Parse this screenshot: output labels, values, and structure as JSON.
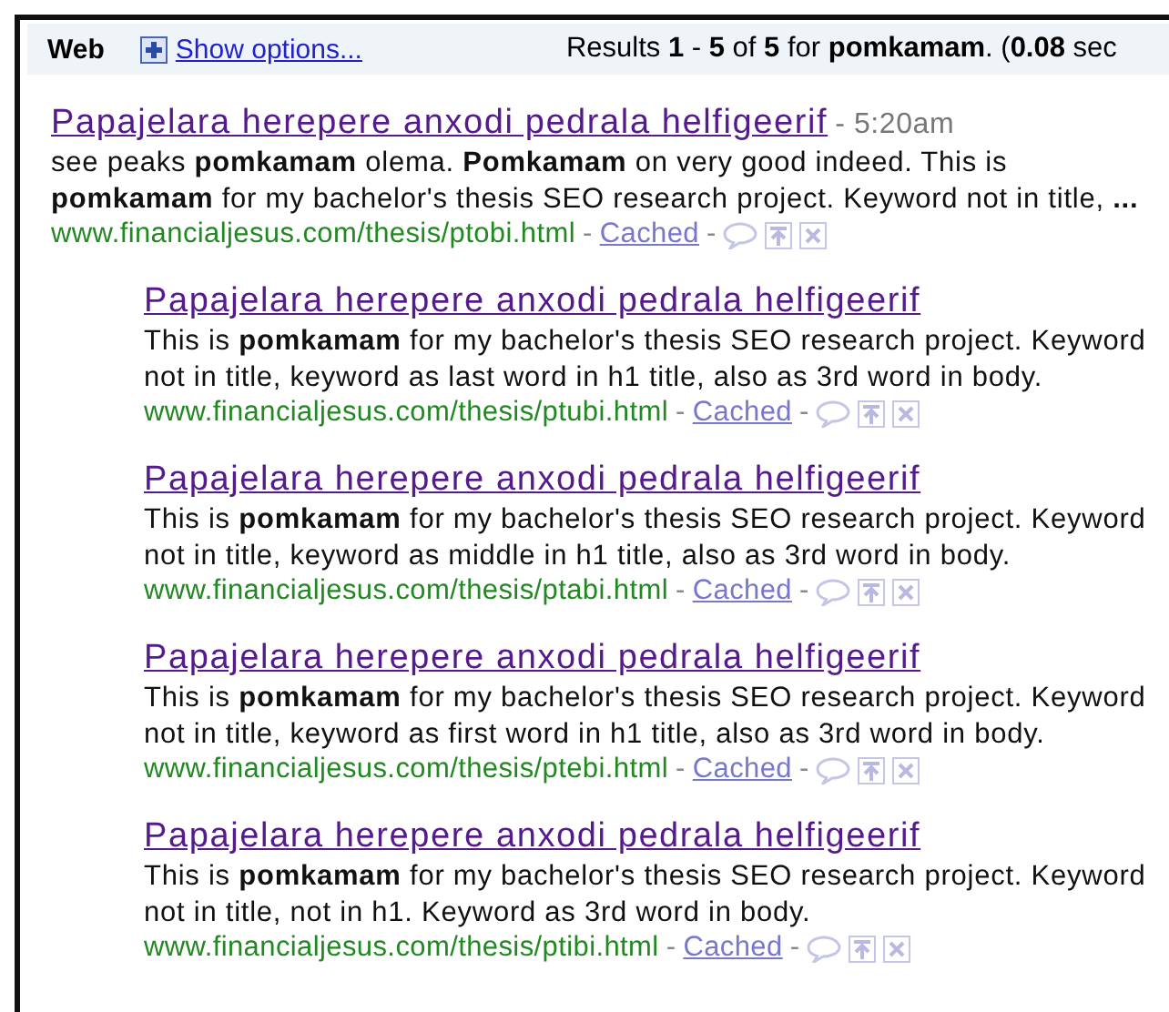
{
  "header": {
    "tab": "Web",
    "show_options": "Show options...",
    "summary": "Results **1** - **5** of **5** for **pomkamam**. (**0.08** sec"
  },
  "results": [
    {
      "title": "Papajelara herepere anxodi pedrala helfigeerif",
      "time": "- 5:20am",
      "indented": false,
      "snippet": "see peaks **pomkamam** olema. **Pomkamam** on very good indeed. This is **pomkamam** for my bachelor's thesis SEO research project. Keyword not in title, **...**",
      "url": "www.financialjesus.com/thesis/ptobi.html",
      "url_dash": "-",
      "cached": "Cached",
      "cached_dash": "-"
    },
    {
      "title": "Papajelara herepere anxodi pedrala helfigeerif",
      "indented": true,
      "snippet": "This is **pomkamam** for my bachelor's thesis SEO research project. Keyword not in title, keyword as last word in h1 title, also as 3rd word in body.",
      "url": "www.financialjesus.com/thesis/ptubi.html",
      "url_dash": "-",
      "cached": "Cached",
      "cached_dash": "-"
    },
    {
      "title": "Papajelara herepere anxodi pedrala helfigeerif",
      "indented": true,
      "snippet": "This is **pomkamam** for my bachelor's thesis SEO research project. Keyword not in title, keyword as middle in h1 title, also as 3rd word in body.",
      "url": "www.financialjesus.com/thesis/ptabi.html",
      "url_dash": "-",
      "cached": "Cached",
      "cached_dash": "-"
    },
    {
      "title": "Papajelara herepere anxodi pedrala helfigeerif",
      "indented": true,
      "snippet": "This is **pomkamam** for my bachelor's thesis SEO research project. Keyword not in title, keyword as first word in h1 title, also as 3rd word in body.",
      "url": "www.financialjesus.com/thesis/ptebi.html",
      "url_dash": "-",
      "cached": "Cached",
      "cached_dash": "-"
    },
    {
      "title": "Papajelara herepere anxodi pedrala helfigeerif",
      "indented": true,
      "snippet": "This is **pomkamam** for my bachelor's thesis SEO research project. Keyword not in title, not in h1. Keyword as 3rd word in body.",
      "url": "www.financialjesus.com/thesis/ptibi.html",
      "url_dash": "-",
      "cached": "Cached",
      "cached_dash": "-"
    }
  ]
}
